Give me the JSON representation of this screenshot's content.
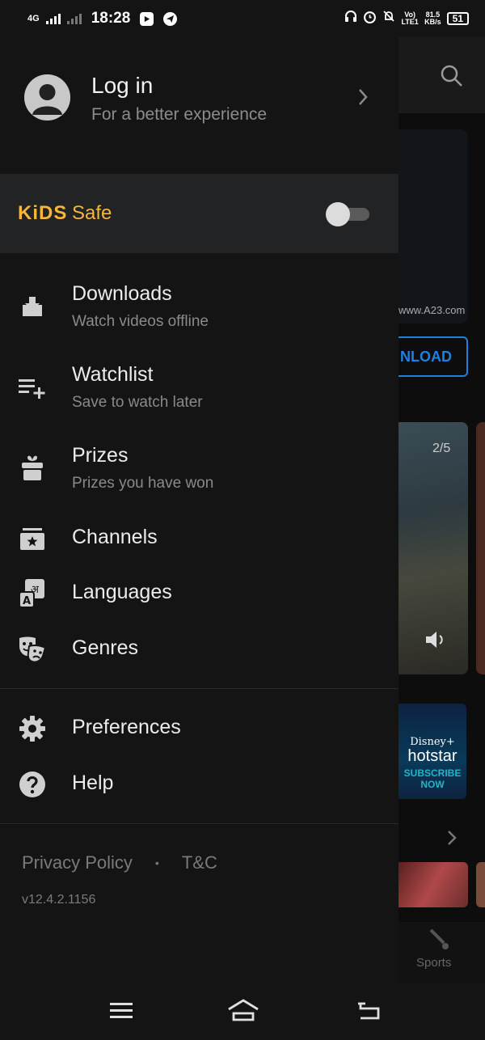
{
  "status_bar": {
    "network": "4G",
    "time": "18:28",
    "data_speed": "81.5",
    "data_unit": "KB/s",
    "volte": "Vo) LTE1",
    "battery": "51"
  },
  "drawer": {
    "login": {
      "title": "Log in",
      "subtitle": "For a better experience"
    },
    "kids": {
      "logo": "KiDS",
      "label": "Safe",
      "enabled": false
    },
    "menu": [
      {
        "title": "Downloads",
        "subtitle": "Watch videos offline",
        "icon": "download-icon"
      },
      {
        "title": "Watchlist",
        "subtitle": "Save to watch later",
        "icon": "playlist-add-icon"
      },
      {
        "title": "Prizes",
        "subtitle": "Prizes you have won",
        "icon": "gift-icon"
      },
      {
        "title": "Channels",
        "icon": "channels-icon"
      },
      {
        "title": "Languages",
        "icon": "languages-icon"
      },
      {
        "title": "Genres",
        "icon": "masks-icon"
      }
    ],
    "secondary": [
      {
        "title": "Preferences",
        "icon": "gear-icon"
      },
      {
        "title": "Help",
        "icon": "help-icon"
      }
    ],
    "footer": {
      "privacy": "Privacy Policy",
      "separator": "•",
      "tnc": "T&C",
      "version": "v12.4.2.1156"
    }
  },
  "background": {
    "url_text": "www.A23.com",
    "download_label": "NLOAD",
    "hero_counter": "2/5",
    "promo_brand": "Disney+",
    "promo_name": "hotstar",
    "promo_cta_1": "SUBSCRIBE",
    "promo_cta_2": "NOW",
    "tab_sports": "Sports"
  },
  "colors": {
    "accent_kids": "#f5b63a",
    "accent_blue": "#1f80e0",
    "drawer_bg": "#141414",
    "kids_bg": "#222324"
  }
}
